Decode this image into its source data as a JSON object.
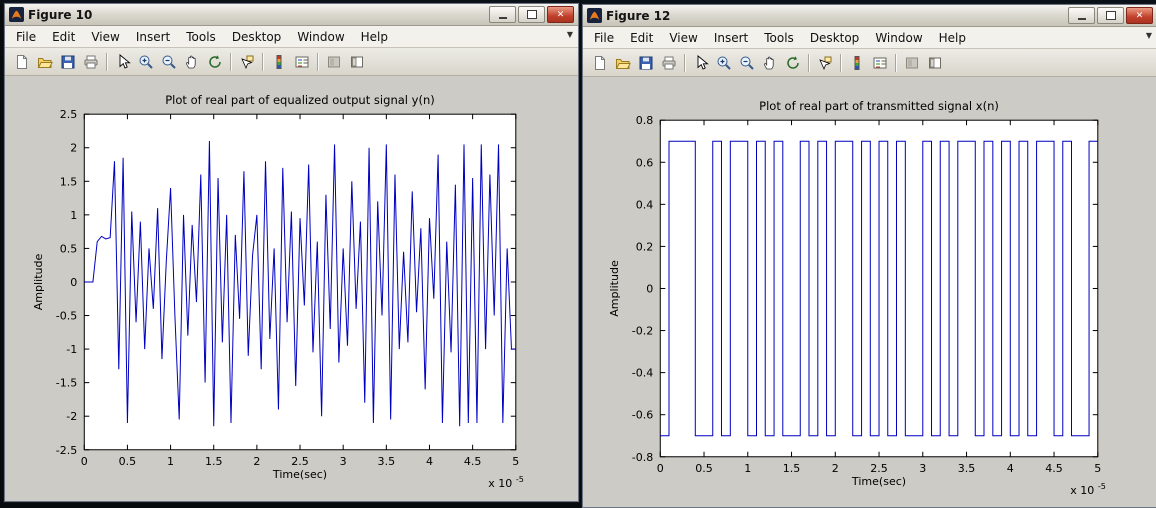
{
  "windows": [
    {
      "title": "Figure 10"
    },
    {
      "title": "Figure 12"
    }
  ],
  "controls": {
    "close_glyph": "✕"
  },
  "icons": {
    "menu_overflow": "▼"
  },
  "menu": {
    "items": [
      "File",
      "Edit",
      "View",
      "Insert",
      "Tools",
      "Desktop",
      "Window",
      "Help"
    ]
  },
  "toolbar": {
    "items": [
      "new-document",
      "open-folder",
      "save",
      "print",
      "|",
      "edit-plot-pointer",
      "zoom-in",
      "zoom-out",
      "pan",
      "rotate-3d",
      "|",
      "data-cursor",
      "|",
      "insert-colorbar",
      "insert-legend",
      "|",
      "hide-plot-tools",
      "show-plot-tools"
    ]
  },
  "colors": {
    "line": "#0000c0",
    "axes": "#000000",
    "figure_bg": "#cdcbc5",
    "plot_bg": "#ffffff"
  },
  "chart_data": [
    {
      "type": "line",
      "title": "Plot of real part of equalized output signal y(n)",
      "xlabel": "Time(sec)",
      "ylabel": "Amplitude",
      "xlim": [
        0,
        5
      ],
      "ylim": [
        -2.5,
        2.5
      ],
      "xticks": [
        0,
        0.5,
        1,
        1.5,
        2,
        2.5,
        3,
        3.5,
        4,
        4.5,
        5
      ],
      "yticks": [
        -2.5,
        -2,
        -1.5,
        -1,
        -0.5,
        0,
        0.5,
        1,
        1.5,
        2,
        2.5
      ],
      "x_exponent_label": "x 10",
      "x_exponent": "-5",
      "grid": false,
      "legend": null,
      "x_start": 0,
      "x_step": 0.05,
      "y": [
        0,
        0,
        0,
        0.6,
        0.68,
        0.64,
        0.66,
        1.8,
        -1.3,
        1.85,
        -2.1,
        1.05,
        -0.6,
        0.9,
        -1.0,
        0.5,
        -0.4,
        1.1,
        -1.15,
        0.3,
        1.4,
        -0.5,
        -2.05,
        1.0,
        -0.8,
        0.85,
        -0.3,
        1.6,
        -1.5,
        2.1,
        -2.15,
        1.55,
        -0.9,
        1.0,
        -2.1,
        0.7,
        -0.55,
        1.65,
        -1.1,
        0.4,
        1.0,
        -1.3,
        1.8,
        -0.85,
        0.5,
        -1.9,
        1.7,
        -0.6,
        1.05,
        -1.55,
        0.95,
        -0.35,
        1.75,
        -1.05,
        0.6,
        -2.0,
        1.3,
        -0.7,
        2.05,
        -1.2,
        0.5,
        -0.95,
        1.5,
        -0.4,
        0.9,
        -1.8,
        2.0,
        -2.1,
        1.2,
        -0.5,
        2.05,
        -2.05,
        1.6,
        -1.0,
        0.45,
        -0.9,
        1.35,
        -0.45,
        0.8,
        -1.6,
        0.95,
        -0.25,
        1.9,
        -2.1,
        0.6,
        -1.05,
        1.45,
        -2.15,
        2.05,
        -2.1,
        1.55,
        -2.1,
        2.05,
        -1.0,
        1.6,
        -0.5,
        2.05,
        -2.1,
        0.5,
        -1.0,
        -1.0
      ]
    },
    {
      "type": "step",
      "title": "Plot of real part of transmitted signal x(n)",
      "xlabel": "Time(sec)",
      "ylabel": "Amplitude",
      "xlim": [
        0,
        5
      ],
      "ylim": [
        -0.8,
        0.8
      ],
      "xticks": [
        0,
        0.5,
        1,
        1.5,
        2,
        2.5,
        3,
        3.5,
        4,
        4.5,
        5
      ],
      "yticks": [
        -0.8,
        -0.6,
        -0.4,
        -0.2,
        0,
        0.2,
        0.4,
        0.6,
        0.8
      ],
      "x_exponent_label": "x 10",
      "x_exponent": "-5",
      "grid": false,
      "legend": null,
      "symbol_period": 0.1,
      "levels": [
        -0.7,
        0.7,
        0.7,
        0.7,
        -0.7,
        -0.7,
        0.7,
        -0.7,
        0.7,
        0.7,
        -0.7,
        0.7,
        -0.7,
        0.7,
        -0.7,
        -0.7,
        0.7,
        -0.7,
        0.7,
        -0.7,
        0.7,
        0.7,
        -0.7,
        0.7,
        -0.7,
        0.7,
        -0.7,
        0.7,
        -0.7,
        -0.7,
        0.7,
        -0.7,
        0.7,
        -0.7,
        0.7,
        0.7,
        -0.7,
        0.7,
        -0.7,
        0.7,
        -0.7,
        0.7,
        -0.7,
        0.7,
        0.7,
        -0.7,
        0.7,
        -0.7,
        -0.7,
        0.7
      ]
    }
  ]
}
